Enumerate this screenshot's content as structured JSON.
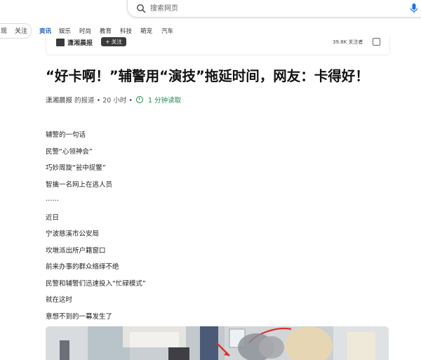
{
  "search": {
    "placeholder": "搜索网页"
  },
  "nav": {
    "left_pill": [
      "现",
      "关注"
    ],
    "items": [
      "资讯",
      "娱乐",
      "时尚",
      "教育",
      "科技",
      "萌宠",
      "汽车"
    ],
    "active_index": 0
  },
  "source_strip": {
    "name": "潇湘晨报",
    "follow_label": "+ 关注",
    "followers": "39.8K 关注者"
  },
  "article": {
    "title": "“好卡啊！”辅警用“演技”拖延时间，网友：卡得好！",
    "source": "潇湘晨报",
    "report": "的报道",
    "dot1": "•",
    "time": "20 小时",
    "dot2": "•",
    "read_time": "1 分钟读取",
    "lines": [
      "辅警的一句话",
      "民警“心领神会”",
      "巧妙周旋“瓮中捉鳖”",
      "智擒一名网上在逃人员",
      "……",
      "近日",
      "宁波慈溪市公安局",
      "坎墩派出所户籍窗口",
      "前来办事的群众络绎不绝",
      "民警和辅警们迅速投入“忙碌模式”",
      "就在这时",
      "意想不到的一幕发生了"
    ]
  },
  "colors": {
    "accent": "#1a56b8",
    "read_time_green": "#1b8a4d",
    "annotation_red": "#d9322b"
  }
}
